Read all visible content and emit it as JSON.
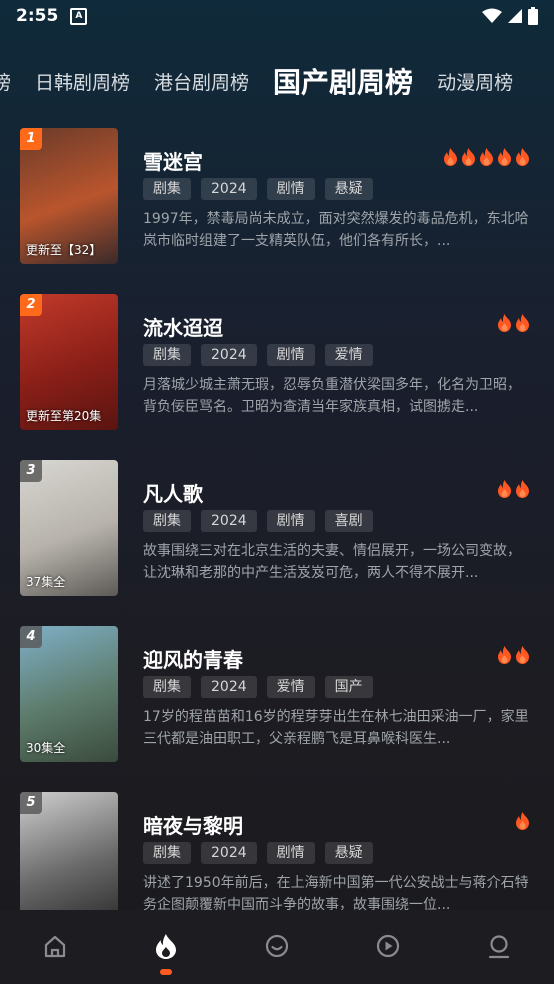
{
  "status": {
    "time": "2:55"
  },
  "tabs": [
    {
      "label": "榜",
      "partial": true
    },
    {
      "label": "日韩剧周榜"
    },
    {
      "label": "港台剧周榜"
    },
    {
      "label": "国产剧周榜",
      "active": true
    },
    {
      "label": "动漫周榜"
    }
  ],
  "items": [
    {
      "rank": "1",
      "title": "雪迷宫",
      "heat": 5,
      "caption": "更新至【32】",
      "tags": [
        "剧集",
        "2024",
        "剧情",
        "悬疑"
      ],
      "desc": "1997年，禁毒局尚未成立，面对突然爆发的毒品危机，东北哈岚市临时组建了一支精英队伍，他们各有所长，...",
      "poster_colors": [
        "#6b3b2a",
        "#b9552d",
        "#3a2a2a"
      ]
    },
    {
      "rank": "2",
      "title": "流水迢迢",
      "heat": 2,
      "caption": "更新至第20集",
      "tags": [
        "剧集",
        "2024",
        "剧情",
        "爱情"
      ],
      "desc": "月落城少城主萧无瑕，忍辱负重潜伏梁国多年，化名为卫昭，背负佞臣骂名。卫昭为查清当年家族真相，试图掳走...",
      "poster_colors": [
        "#c23a2a",
        "#8a1f18",
        "#5a1410"
      ]
    },
    {
      "rank": "3",
      "title": "凡人歌",
      "heat": 2,
      "caption": "37集全",
      "tags": [
        "剧集",
        "2024",
        "剧情",
        "喜剧"
      ],
      "desc": "故事围绕三对在北京生活的夫妻、情侣展开，一场公司变故，让沈琳和老那的中产生活岌岌可危，两人不得不展开...",
      "poster_colors": [
        "#d9d7d2",
        "#b7b3ac",
        "#5d5a56"
      ]
    },
    {
      "rank": "4",
      "title": "迎风的青春",
      "heat": 2,
      "caption": "30集全",
      "tags": [
        "剧集",
        "2024",
        "爱情",
        "国产"
      ],
      "desc": "17岁的程苗苗和16岁的程芽芽出生在林七油田采油一厂，家里三代都是油田职工，父亲程鹏飞是耳鼻喉科医生...",
      "poster_colors": [
        "#7fb0c8",
        "#5c7a6a",
        "#3a4a3c"
      ]
    },
    {
      "rank": "5",
      "title": "暗夜与黎明",
      "heat": 1,
      "caption": "",
      "tags": [
        "剧集",
        "2024",
        "剧情",
        "悬疑"
      ],
      "desc": "讲述了1950年前后，在上海新中国第一代公安战士与蒋介石特务企图颠覆新中国而斗争的故事，故事围绕一位...",
      "poster_colors": [
        "#cfcfcf",
        "#6a6a6a",
        "#2a2a2a"
      ]
    }
  ],
  "nav": [
    {
      "name": "home-icon"
    },
    {
      "name": "fire-icon",
      "active": true
    },
    {
      "name": "chat-icon"
    },
    {
      "name": "play-icon"
    },
    {
      "name": "profile-icon"
    }
  ],
  "colors": {
    "accent": "#ff5a1f",
    "fire": "#ff5722"
  }
}
